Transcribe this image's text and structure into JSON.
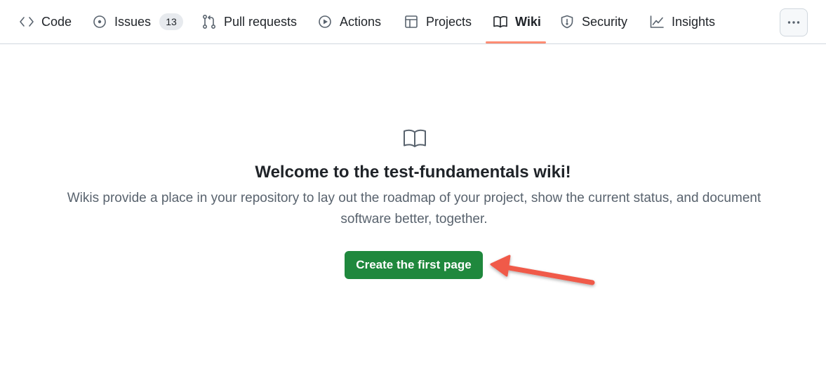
{
  "tabs": [
    {
      "label": "Code",
      "icon": "code-icon"
    },
    {
      "label": "Issues",
      "icon": "issue-opened-icon",
      "count": "13"
    },
    {
      "label": "Pull requests",
      "icon": "git-pull-request-icon"
    },
    {
      "label": "Actions",
      "icon": "play-icon"
    },
    {
      "label": "Projects",
      "icon": "table-icon"
    },
    {
      "label": "Wiki",
      "icon": "book-icon",
      "selected": true
    },
    {
      "label": "Security",
      "icon": "shield-icon"
    },
    {
      "label": "Insights",
      "icon": "graph-icon"
    }
  ],
  "more_button": {
    "icon": "kebab-horizontal-icon"
  },
  "blankslate": {
    "icon": "book-icon",
    "title": "Welcome to the test-fundamentals wiki!",
    "description": "Wikis provide a place in your repository to lay out the roadmap of your project, show the current status, and document software better, together.",
    "button_label": "Create the first page"
  },
  "annotation": {
    "icon": "arrow-icon",
    "color": "#f05a4a"
  },
  "colors": {
    "accent_underline": "#fd8c73",
    "primary_button": "#1f883d",
    "text_primary": "#1f2328",
    "text_muted": "#59636e"
  }
}
